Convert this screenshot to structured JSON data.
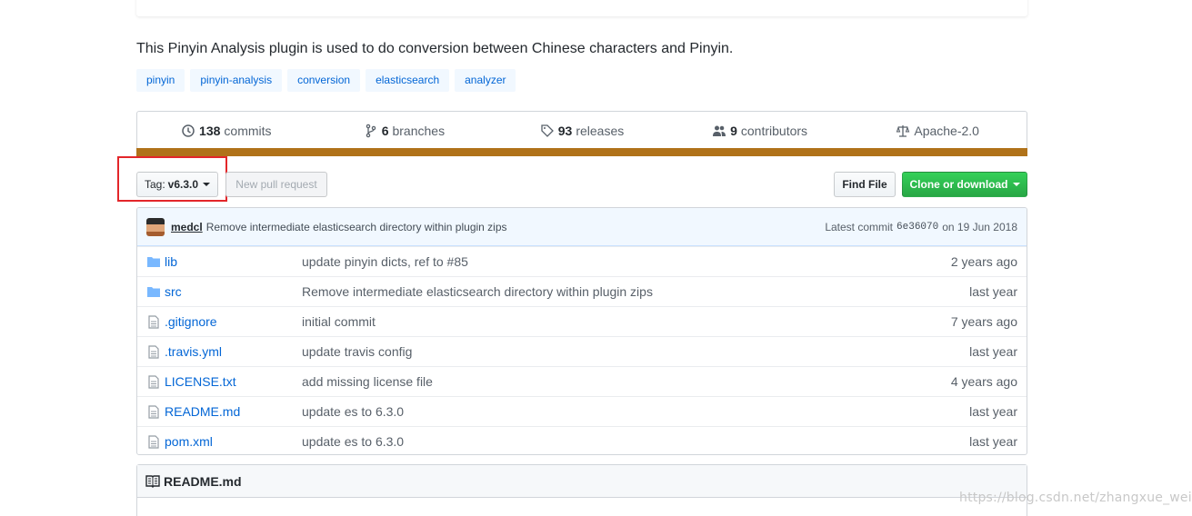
{
  "description": "This Pinyin Analysis plugin is used to do conversion between Chinese characters and Pinyin.",
  "topics": [
    "pinyin",
    "pinyin-analysis",
    "conversion",
    "elasticsearch",
    "analyzer"
  ],
  "summary": {
    "commits": {
      "num": "138",
      "label": "commits"
    },
    "branches": {
      "num": "6",
      "label": "branches"
    },
    "releases": {
      "num": "93",
      "label": "releases"
    },
    "contributors": {
      "num": "9",
      "label": "contributors"
    },
    "license": "Apache-2.0",
    "language_color": "#b07219"
  },
  "toolbar": {
    "tag_prefix": "Tag:",
    "tag_value": "v6.3.0",
    "new_pr": "New pull request",
    "find_file": "Find File",
    "clone": "Clone or download"
  },
  "latest_commit": {
    "author": "medcl",
    "message": "Remove intermediate elasticsearch directory within plugin zips",
    "prefix": "Latest commit",
    "sha": "6e36070",
    "date": "on 19 Jun 2018"
  },
  "files": [
    {
      "type": "dir",
      "name": "lib",
      "message": "update pinyin dicts, ref to #85",
      "age": "2 years ago"
    },
    {
      "type": "dir",
      "name": "src",
      "message": "Remove intermediate elasticsearch directory within plugin zips",
      "age": "last year"
    },
    {
      "type": "file",
      "name": ".gitignore",
      "message": "initial commit",
      "age": "7 years ago"
    },
    {
      "type": "file",
      "name": ".travis.yml",
      "message": "update travis config",
      "age": "last year"
    },
    {
      "type": "file",
      "name": "LICENSE.txt",
      "message": "add missing license file",
      "age": "4 years ago"
    },
    {
      "type": "file",
      "name": "README.md",
      "message": "update es to 6.3.0",
      "age": "last year"
    },
    {
      "type": "file",
      "name": "pom.xml",
      "message": "update es to 6.3.0",
      "age": "last year"
    }
  ],
  "readme": {
    "title": "README.md"
  },
  "watermark": "https://blog.csdn.net/zhangxue_wei"
}
